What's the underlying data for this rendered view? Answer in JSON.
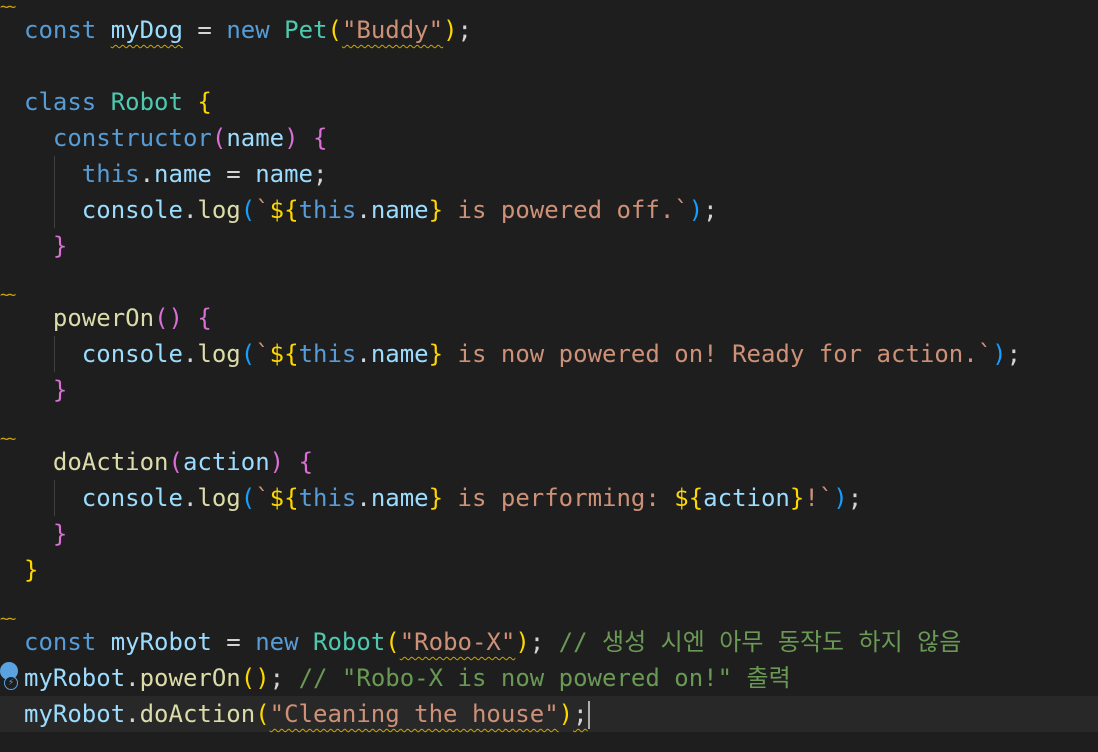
{
  "editor": {
    "theme": "dark",
    "colors": {
      "background": "#1e1e1e",
      "keyword": "#569cd6",
      "function": "#dcdcaa",
      "class": "#4ec9b0",
      "variable": "#9cdcfe",
      "string": "#ce9178",
      "comment": "#6a9955",
      "warning": "#cca700"
    },
    "warning_icon": "squiggle-warning-icon",
    "lightbulb_icon": "lightbulb-autofix-icon",
    "fold_marker": "~~",
    "bulb_sub_glyph": "⚡"
  },
  "code": {
    "l1": {
      "kw": "const",
      "name": "myDog",
      "op": " = ",
      "new": "new",
      "cls": "Pet",
      "p1": "(",
      "str": "\"Buddy\"",
      "p2": ")",
      "end": ";"
    },
    "l3": {
      "kw": "class",
      "cls": "Robot",
      "brace": "{"
    },
    "l4": {
      "fn": "constructor",
      "p1": "(",
      "param": "name",
      "p2": ")",
      "brace": "{"
    },
    "l5": {
      "this": "this",
      "dot": ".",
      "prop": "name",
      "op": " = ",
      "val": "name",
      "end": ";"
    },
    "l6": {
      "obj": "console",
      "dot": ".",
      "fn": "log",
      "p1": "(",
      "tick": "`",
      "d1": "${",
      "this": "this",
      "dot2": ".",
      "prop": "name",
      "d2": "}",
      "text": " is powered off.",
      "tick2": "`",
      "p2": ")",
      "end": ";"
    },
    "l7": {
      "brace": "}"
    },
    "l9": {
      "fn": "powerOn",
      "parens": "()",
      "brace": "{"
    },
    "l10": {
      "obj": "console",
      "dot": ".",
      "fn": "log",
      "p1": "(",
      "tick": "`",
      "d1": "${",
      "this": "this",
      "dot2": ".",
      "prop": "name",
      "d2": "}",
      "text": " is now powered on! Ready for action.",
      "tick2": "`",
      "p2": ")",
      "end": ";"
    },
    "l11": {
      "brace": "}"
    },
    "l13": {
      "fn": "doAction",
      "p1": "(",
      "param": "action",
      "p2": ")",
      "brace": "{"
    },
    "l14": {
      "obj": "console",
      "dot": ".",
      "fn": "log",
      "p1": "(",
      "tick": "`",
      "d1": "${",
      "this": "this",
      "dot2": ".",
      "prop": "name",
      "d2": "}",
      "text": " is performing: ",
      "d3": "${",
      "param": "action",
      "d4": "}",
      "text2": "!",
      "tick2": "`",
      "p2": ")",
      "end": ";"
    },
    "l15": {
      "brace": "}"
    },
    "l16": {
      "brace": "}"
    },
    "l18": {
      "kw": "const",
      "name": "myRobot",
      "op": " = ",
      "new": "new",
      "cls": "Robot",
      "p1": "(",
      "str": "\"Robo-X\"",
      "p2": ")",
      "end": ";",
      "comment": " // 생성 시엔 아무 동작도 하지 않음"
    },
    "l19": {
      "obj": "myRobot",
      "dot": ".",
      "fn": "powerOn",
      "parens": "()",
      "end": ";",
      "comment": " // \"Robo-X is now powered on!\" 출력"
    },
    "l20": {
      "obj": "myRobot",
      "dot": ".",
      "fn": "doAction",
      "p1": "(",
      "str": "\"Cleaning the house\"",
      "p2": ")",
      "end": ";"
    }
  }
}
